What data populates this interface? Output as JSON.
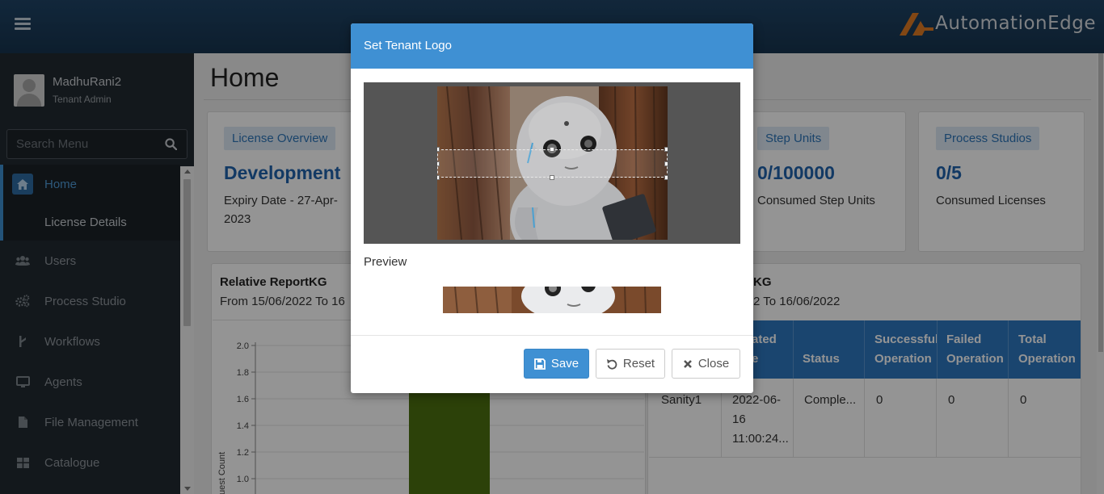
{
  "header": {
    "brand": "AutomationEdge"
  },
  "sidebar": {
    "user_name": "MadhuRani2",
    "user_role": "Tenant Admin",
    "search_placeholder": "Search Menu",
    "items": [
      {
        "label": "Home",
        "icon": "home-icon",
        "active": true
      },
      {
        "label": "Users",
        "icon": "users-icon"
      },
      {
        "label": "Process Studio",
        "icon": "cogs-icon"
      },
      {
        "label": "Workflows",
        "icon": "workflow-icon"
      },
      {
        "label": "Agents",
        "icon": "monitor-icon"
      },
      {
        "label": "File Management",
        "icon": "file-icon"
      },
      {
        "label": "Catalogue",
        "icon": "grid-icon"
      }
    ],
    "submenu": "License Details"
  },
  "main": {
    "title": "Home",
    "license_card": {
      "badge": "License Overview",
      "value": "Development",
      "text1": "Expiry Date - 27-Apr-",
      "text2": "2023"
    },
    "step_card": {
      "badge": "Step Units",
      "value": "0/100000",
      "text": "Consumed Step Units"
    },
    "studio_card": {
      "badge": "Process Studios",
      "value": "0/5",
      "text": "Consumed Licenses"
    },
    "report_left": {
      "title": "Relative ReportKG",
      "sub": "From 15/06/2022 To 16"
    },
    "report_right": {
      "title": "KG",
      "sub": "2 To 16/06/2022"
    }
  },
  "chart_data": {
    "type": "bar",
    "ylabel": "uest Count",
    "yticks": [
      "2.0",
      "1.8",
      "1.6",
      "1.4",
      "1.2",
      "1.0"
    ],
    "ylim": [
      1.0,
      2.0
    ],
    "bar_color": "#4d7010",
    "values": [
      2.0
    ]
  },
  "table": {
    "headers": [
      {
        "line1": "ated",
        "line2": "e"
      },
      {
        "line1": "",
        "line2": "Status"
      },
      {
        "line1": "Successful",
        "line2": "Operation"
      },
      {
        "line1": "Failed",
        "line2": "Operation"
      },
      {
        "line1": "Total",
        "line2": "Operation"
      }
    ],
    "row": {
      "name": "Sanity1",
      "date1": "2022-06-",
      "date2": "16",
      "date3": "11:00:24...",
      "status": "Comple...",
      "successful": "0",
      "failed": "0",
      "total": "0"
    }
  },
  "modal": {
    "title": "Set Tenant Logo",
    "preview_label": "Preview",
    "save": "Save",
    "reset": "Reset",
    "close": "Close"
  },
  "colors": {
    "header": "#1f4466",
    "sidebar": "#222a31",
    "accent": "#3f90d3",
    "brand_orange": "#e07b24"
  }
}
